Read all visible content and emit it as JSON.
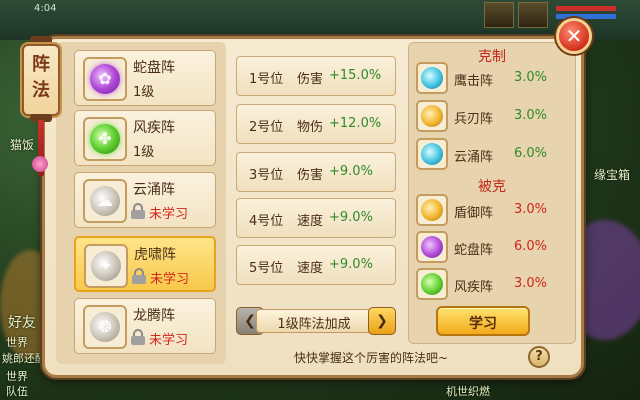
{
  "background": {
    "status_text": "4:04",
    "labels": [
      "猫饭",
      "好友",
      "世界",
      "姚郎还酬",
      "世界",
      "队伍",
      "缘宝箱",
      "机世织燃"
    ]
  },
  "title": "阵法",
  "formations": [
    {
      "name": "蛇盘阵",
      "level": "1级",
      "status": "",
      "orb": "purple",
      "glyph": "✿",
      "locked": false,
      "selected": false
    },
    {
      "name": "风疾阵",
      "level": "1级",
      "status": "",
      "orb": "green",
      "glyph": "✤",
      "locked": false,
      "selected": false
    },
    {
      "name": "云涌阵",
      "level": "",
      "status": "未学习",
      "orb": "grey",
      "glyph": "☁",
      "locked": true,
      "selected": false
    },
    {
      "name": "虎啸阵",
      "level": "",
      "status": "未学习",
      "orb": "grey",
      "glyph": "✦",
      "locked": true,
      "selected": true
    },
    {
      "name": "龙腾阵",
      "level": "",
      "status": "未学习",
      "orb": "grey",
      "glyph": "❂",
      "locked": true,
      "selected": false
    }
  ],
  "positions": [
    {
      "name": "1号位",
      "attr": "伤害",
      "value": "+15.0%"
    },
    {
      "name": "2号位",
      "attr": "物伤",
      "value": "+12.0%"
    },
    {
      "name": "3号位",
      "attr": "伤害",
      "value": "+9.0%"
    },
    {
      "name": "4号位",
      "attr": "速度",
      "value": "+9.0%"
    },
    {
      "name": "5号位",
      "attr": "速度",
      "value": "+9.0%"
    }
  ],
  "level_nav": {
    "label": "1级阵法加成",
    "prev": "❮",
    "next": "❯"
  },
  "counters": {
    "title": "克制",
    "items": [
      {
        "name": "鹰击阵",
        "value": "3.0%",
        "orb": "blue"
      },
      {
        "name": "兵刃阵",
        "value": "3.0%",
        "orb": "gold"
      },
      {
        "name": "云涌阵",
        "value": "6.0%",
        "orb": "blue"
      }
    ]
  },
  "countered_by": {
    "title": "被克",
    "items": [
      {
        "name": "盾御阵",
        "value": "3.0%",
        "orb": "gold"
      },
      {
        "name": "蛇盘阵",
        "value": "6.0%",
        "orb": "purple"
      },
      {
        "name": "风疾阵",
        "value": "3.0%",
        "orb": "green"
      }
    ]
  },
  "learn_button": "学习",
  "hint": "快快掌握这个厉害的阵法吧~",
  "help": "?",
  "close": "✕",
  "colors": {
    "positive": "#2f8a2a",
    "negative": "#d0261c",
    "selected": "#f8c84a"
  }
}
